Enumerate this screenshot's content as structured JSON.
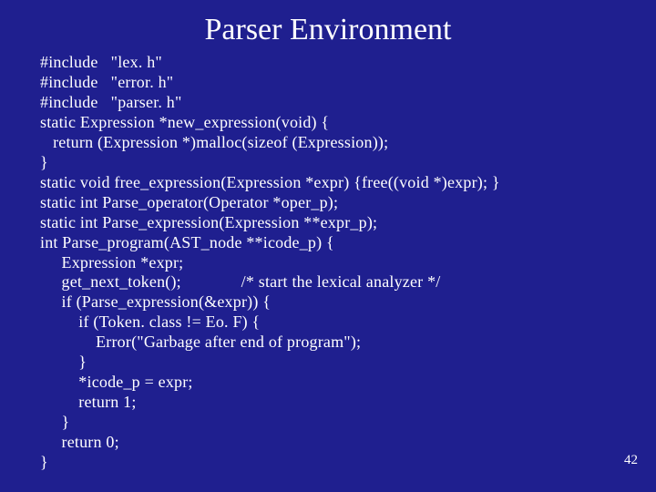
{
  "title": "Parser Environment",
  "pagenum": "42",
  "code": "#include   \"lex. h\"\n#include   \"error. h\"\n#include   \"parser. h\"\nstatic Expression *new_expression(void) {\n   return (Expression *)malloc(sizeof (Expression));\n}\nstatic void free_expression(Expression *expr) {free((void *)expr); }\nstatic int Parse_operator(Operator *oper_p);\nstatic int Parse_expression(Expression **expr_p);\nint Parse_program(AST_node **icode_p) {\n     Expression *expr;\n     get_next_token();              /* start the lexical analyzer */\n     if (Parse_expression(&expr)) {\n         if (Token. class != Eo. F) {\n             Error(\"Garbage after end of program\");\n         }\n         *icode_p = expr;\n         return 1;\n     }\n     return 0;\n}"
}
